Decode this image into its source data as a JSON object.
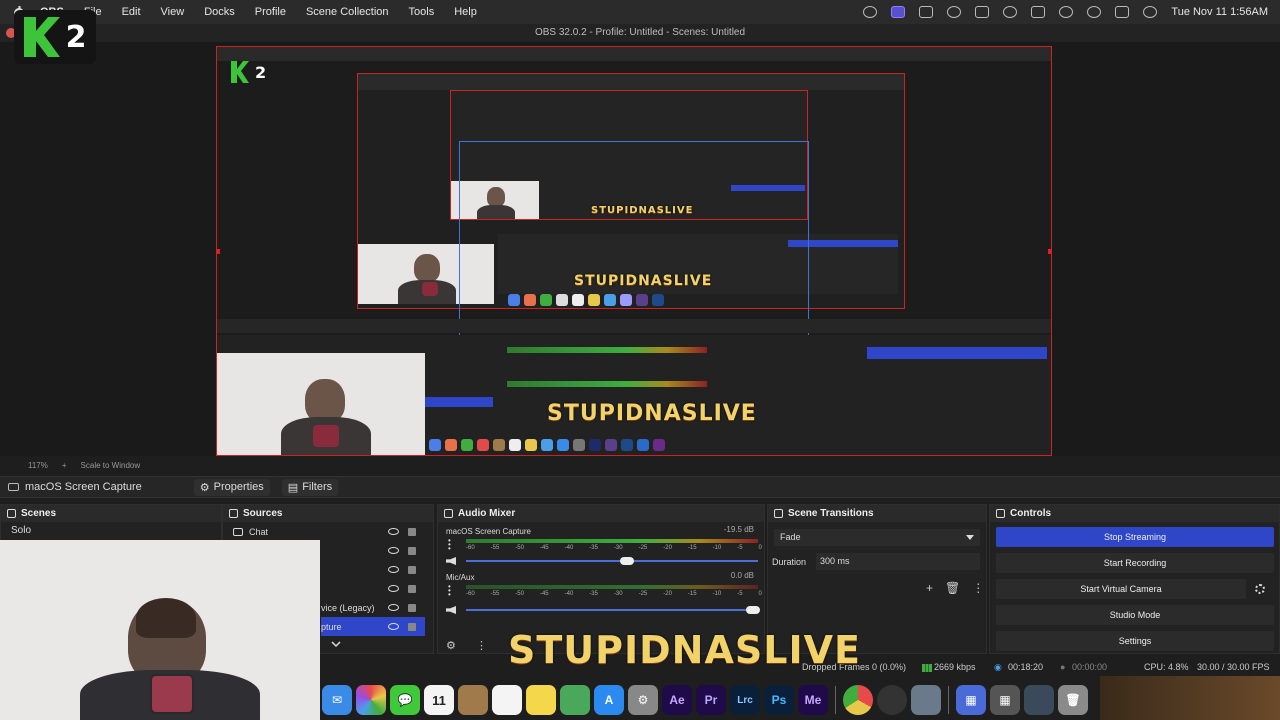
{
  "menubar": {
    "app": "OBS",
    "items": [
      "File",
      "Edit",
      "View",
      "Docks",
      "Profile",
      "Scene Collection",
      "Tools",
      "Help"
    ],
    "clock": "Tue Nov 11  1:56AM"
  },
  "window": {
    "title": "OBS 32.0.2 - Profile: Untitled - Scenes: Untitled"
  },
  "logo": {
    "text": "2"
  },
  "preview": {
    "brand_text": "STUPIDNASLIVE",
    "zoom": "117%",
    "scale_mode": "Scale to Window"
  },
  "source_toolbar": {
    "source_name": "macOS Screen Capture",
    "properties_label": "Properties",
    "filters_label": "Filters"
  },
  "scenes": {
    "title": "Scenes",
    "items": [
      "Solo"
    ]
  },
  "sources": {
    "title": "Sources",
    "items": [
      "Chat",
      "",
      "",
      "",
      "vice (Legacy)",
      "pture"
    ]
  },
  "audio_mixer": {
    "title": "Audio Mixer",
    "channels": [
      {
        "name": "macOS Screen Capture",
        "db": "-19.5 dB",
        "level": 0.92,
        "volume": 0.6
      },
      {
        "name": "Mic/Aux",
        "db": "0.0 dB",
        "level": 0.84,
        "volume": 1.0
      }
    ],
    "ticks": [
      "-60",
      "-55",
      "-50",
      "-45",
      "-40",
      "-35",
      "-30",
      "-25",
      "-20",
      "-15",
      "-10",
      "-5",
      "0"
    ]
  },
  "scene_transitions": {
    "title": "Scene Transitions",
    "transition": "Fade",
    "duration_label": "Duration",
    "duration_value": "300 ms"
  },
  "controls": {
    "title": "Controls",
    "stop_streaming": "Stop Streaming",
    "start_recording": "Start Recording",
    "start_virtual_camera": "Start Virtual Camera",
    "studio_mode": "Studio Mode",
    "settings": "Settings"
  },
  "status": {
    "dropped_frames": "Dropped Frames 0 (0.0%)",
    "bitrate": "2669 kbps",
    "stream_time": "00:18:20",
    "record_time": "00:00:00",
    "cpu": "CPU: 4.8%",
    "fps": "30.00 / 30.00 FPS"
  },
  "brand": {
    "text": "STUPIDNASLIVE"
  },
  "dock_apps": [
    "Mail",
    "Photos",
    "Messages",
    "Calendar",
    "Notes",
    "Reminders",
    "Maps",
    "App Store",
    "Settings",
    "Ae",
    "Pr",
    "Lrc",
    "Ps",
    "Me",
    "Chrome",
    "OBS",
    "Finder",
    "Launchpad",
    "Grid",
    "Screen",
    "Trash"
  ],
  "colors": {
    "accent": "#2f46c8",
    "preview_border": "#cc2222",
    "brand": "#f1d36a"
  }
}
